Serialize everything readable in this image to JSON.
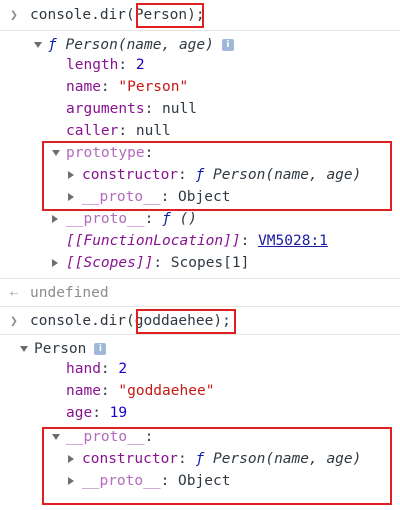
{
  "cmd1": {
    "prefix": "console.dir",
    "open": "(",
    "arg": "Person",
    "close": ")",
    "semi": ";"
  },
  "person_fn": {
    "f": "ƒ",
    "signature": "Person(name, age)",
    "props": {
      "length_key": "length",
      "length_val": "2",
      "name_key": "name",
      "name_val": "\"Person\"",
      "arguments_key": "arguments",
      "arguments_val": "null",
      "caller_key": "caller",
      "caller_val": "null",
      "prototype_key": "prototype",
      "constructor_key": "constructor",
      "constructor_f": "ƒ",
      "constructor_sig": "Person(name, age)",
      "proto_key": "__proto__",
      "proto_val": "Object",
      "fn_proto_key": "__proto__",
      "fn_proto_f": "ƒ",
      "fn_proto_val": "()",
      "location_key": "[[FunctionLocation]]",
      "location_val": "VM5028:1",
      "scopes_key": "[[Scopes]]",
      "scopes_val": "Scopes[1]"
    }
  },
  "undefined_text": "undefined",
  "cmd2": {
    "prefix": "console.dir",
    "open": "(",
    "arg": "goddaehee",
    "close": ")",
    "semi": ";"
  },
  "person_obj": {
    "title": "Person",
    "hand_key": "hand",
    "hand_val": "2",
    "name_key": "name",
    "name_val": "\"goddaehee\"",
    "age_key": "age",
    "age_val": "19",
    "proto_key": "__proto__",
    "constructor_key": "constructor",
    "constructor_f": "ƒ",
    "constructor_sig": "Person(name, age)",
    "inner_proto_key": "__proto__",
    "inner_proto_val": "Object"
  },
  "info_badge": "i",
  "colors": {
    "highlight_box": "#e02020",
    "key": "#881391",
    "string": "#c41a16",
    "number": "#1c00cf"
  }
}
